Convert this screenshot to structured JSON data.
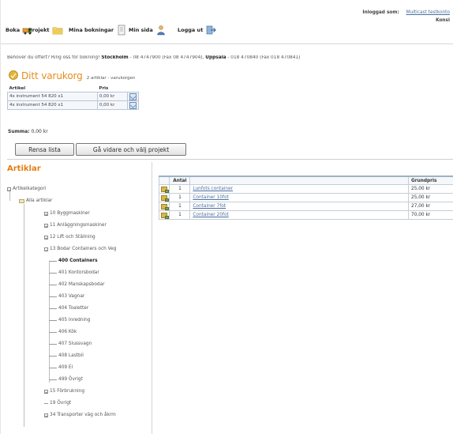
{
  "nav": {
    "items": [
      {
        "label": "Boka",
        "icon": "truck-icon"
      },
      {
        "label": "Projekt",
        "icon": "folder-icon"
      },
      {
        "label": "Mina bokningar",
        "icon": "document-icon"
      },
      {
        "label": "Min sida",
        "icon": "user-icon"
      },
      {
        "label": "Logga ut",
        "icon": "logout-icon"
      }
    ],
    "logged_in_label": "Inloggad som:",
    "logged_in_user": "Multicast testkonto",
    "logged_in_sub": "Konsi"
  },
  "contact": {
    "prefix": "Behöver du offert? Ring oss för bokning!",
    "city1": "Stockholm",
    "city1_detail": "- 08 4747900 (Fax 08 4747904),",
    "city2": "Uppsala",
    "city2_detail": "- 018 470840 (Fax 018 470841)"
  },
  "cart": {
    "title": "Ditt varukorg",
    "subtitle": "2 artiklar - varukorgen",
    "headers": {
      "article": "Artikel",
      "price": "Pris"
    },
    "items": [
      {
        "article": "4x instrument 54 820 x1",
        "price": "0,00 kr"
      },
      {
        "article": "4x instrument 54 820 x1",
        "price": "0,00 kr"
      }
    ],
    "sum_label": "Summa:",
    "sum_value": "0,00 kr",
    "buttons": {
      "clear": "Rensa lista",
      "continue": "Gå vidare och välj projekt"
    }
  },
  "sidebar": {
    "title": "Artiklar",
    "tree": [
      {
        "label": "Artikelkategori",
        "level": 0,
        "expander": "−"
      },
      {
        "label": "Alla artiklar",
        "level": 1,
        "expander": ""
      },
      {
        "label": "10 Byggmaskiner",
        "level": 2,
        "expander": "+"
      },
      {
        "label": "11 Anläggningsmaskiner",
        "level": 2,
        "expander": "+"
      },
      {
        "label": "12 Lift och Ställning",
        "level": 2,
        "expander": "+"
      },
      {
        "label": "13 Bodar Containers och Veg",
        "level": 2,
        "expander": "−"
      },
      {
        "label": "400 Containers",
        "level": 3,
        "expander": "",
        "selected": true
      },
      {
        "label": "401 Kontorsbodar",
        "level": 3,
        "expander": ""
      },
      {
        "label": "402 Manskapsbodar",
        "level": 3,
        "expander": ""
      },
      {
        "label": "403 Vagnar",
        "level": 3,
        "expander": ""
      },
      {
        "label": "404 Toaletter",
        "level": 3,
        "expander": ""
      },
      {
        "label": "405 Inredning",
        "level": 3,
        "expander": ""
      },
      {
        "label": "406 Kök",
        "level": 3,
        "expander": ""
      },
      {
        "label": "407 Slussvagn",
        "level": 3,
        "expander": ""
      },
      {
        "label": "408 Lastbil",
        "level": 3,
        "expander": ""
      },
      {
        "label": "409 El",
        "level": 3,
        "expander": ""
      },
      {
        "label": "499 Övrigt",
        "level": 3,
        "expander": ""
      },
      {
        "label": "15 Förbrukning",
        "level": 2,
        "expander": "+"
      },
      {
        "label": "19 Övrigt",
        "level": 2,
        "expander": ""
      },
      {
        "label": "34 Transporter väg och åkrm",
        "level": 2,
        "expander": "+"
      }
    ]
  },
  "products": {
    "headers": {
      "qty": "Antal",
      "name": "",
      "price": "Grundpris"
    },
    "rows": [
      {
        "qty": "1",
        "name": "Lunfots container",
        "price": "25,00 kr"
      },
      {
        "qty": "1",
        "name": "Container 10fot",
        "price": "25,00 kr"
      },
      {
        "qty": "1",
        "name": "Container 7fot",
        "price": "27,00 kr"
      },
      {
        "qty": "1",
        "name": "Container 20fot",
        "price": "70,00 kr"
      }
    ]
  }
}
